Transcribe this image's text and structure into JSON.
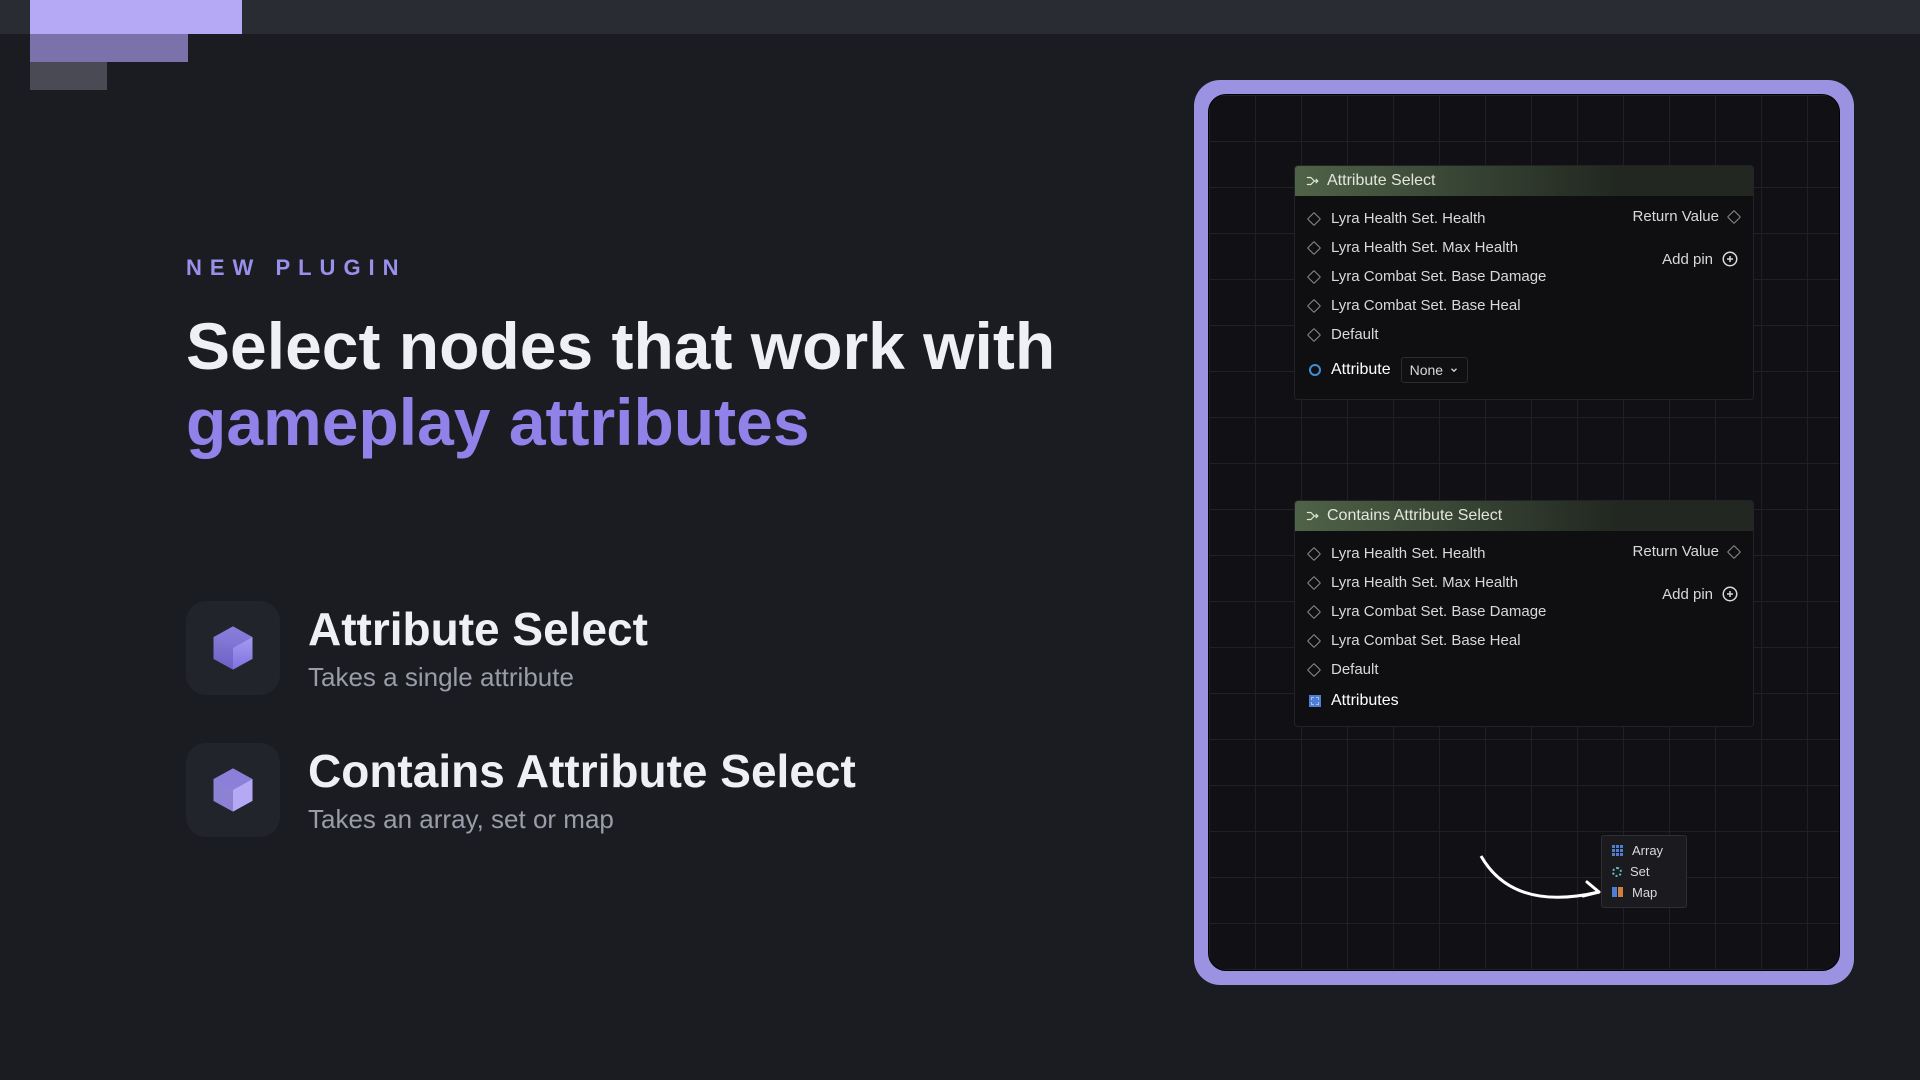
{
  "eyebrow": "NEW PLUGIN",
  "headline_a": "Select nodes that work with",
  "headline_b": "gameplay attributes",
  "features": [
    {
      "title": "Attribute Select",
      "desc": "Takes a single attribute"
    },
    {
      "title": "Contains Attribute Select",
      "desc": "Takes an array, set or map"
    }
  ],
  "node1": {
    "title": "Attribute Select",
    "pins": [
      "Lyra Health Set. Health",
      "Lyra Health Set. Max Health",
      "Lyra Combat Set. Base Damage",
      "Lyra Combat Set. Base Heal",
      "Default"
    ],
    "return": "Return Value",
    "addpin": "Add pin",
    "attr_label": "Attribute",
    "attr_value": "None"
  },
  "node2": {
    "title": "Contains Attribute Select",
    "pins": [
      "Lyra Health Set. Health",
      "Lyra Health Set. Max Health",
      "Lyra Combat Set. Base Damage",
      "Lyra Combat Set. Base Heal",
      "Default"
    ],
    "return": "Return Value",
    "addpin": "Add pin",
    "attrs_label": "Attributes"
  },
  "popout": {
    "items": [
      "Array",
      "Set",
      "Map"
    ]
  }
}
